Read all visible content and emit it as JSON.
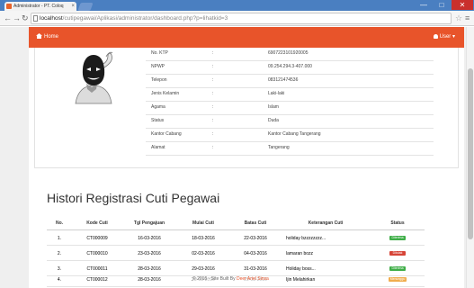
{
  "browser": {
    "tab_title": "Administrator - PT. Coloq",
    "url_host": "localhost",
    "url_path": "/cutipegawai/Aplikasi/administrator/dashboard.php?p=lihatkid=3",
    "window_controls": [
      "—",
      "□",
      "✕"
    ]
  },
  "topnav": {
    "brand": "Home",
    "user": "User ▾",
    "accent": "#e8542a"
  },
  "profile": {
    "rows": [
      {
        "key": "No. KTP",
        "value": "6907223101920005"
      },
      {
        "key": "NPWP",
        "value": "09.254.294.3-407.000"
      },
      {
        "key": "Telepon",
        "value": "083121474536"
      },
      {
        "key": "Jenis Kelamin",
        "value": "Laki-laki"
      },
      {
        "key": "Agama",
        "value": "Islam"
      },
      {
        "key": "Status",
        "value": "Duda"
      },
      {
        "key": "Kantor Cabang",
        "value": "Kantor Cabang Tangerang"
      },
      {
        "key": "Alamat",
        "value": "Tangerang"
      }
    ],
    "separator": ":"
  },
  "history": {
    "title": "Histori Registrasi Cuti Pegawai",
    "columns": [
      "No.",
      "Kode Cuti",
      "Tgl Pengajuan",
      "Mulai Cuti",
      "Batas Cuti",
      "Keterangan Cuti",
      "Status"
    ],
    "rows": [
      {
        "no": "1.",
        "kode": "CT000009",
        "tgl": "16-03-2016",
        "mulai": "18-03-2016",
        "batas": "22-03-2016",
        "ket": "holiday bzzzzzzzz...",
        "status": "Diterima",
        "status_color": "green"
      },
      {
        "no": "2.",
        "kode": "CT000010",
        "tgl": "23-03-2016",
        "mulai": "02-03-2016",
        "batas": "04-03-2016",
        "ket": "lamaran bozz",
        "status": "Ditolak",
        "status_color": "red"
      },
      {
        "no": "3.",
        "kode": "CT000011",
        "tgl": "28-03-2016",
        "mulai": "29-03-2016",
        "batas": "31-03-2016",
        "ket": "Holiday boss...",
        "status": "Diterima",
        "status_color": "green"
      },
      {
        "no": "4.",
        "kode": "CT000012",
        "tgl": "28-03-2016",
        "mulai": "29-03-2016",
        "batas": "29-03-2016",
        "ket": "Ijin Melahirkan",
        "status": "Menunggu",
        "status_color": "yellow"
      }
    ]
  },
  "footer": {
    "text": "© 2016 - Site Built By ",
    "link": "Deer Ariel Sinsa"
  }
}
